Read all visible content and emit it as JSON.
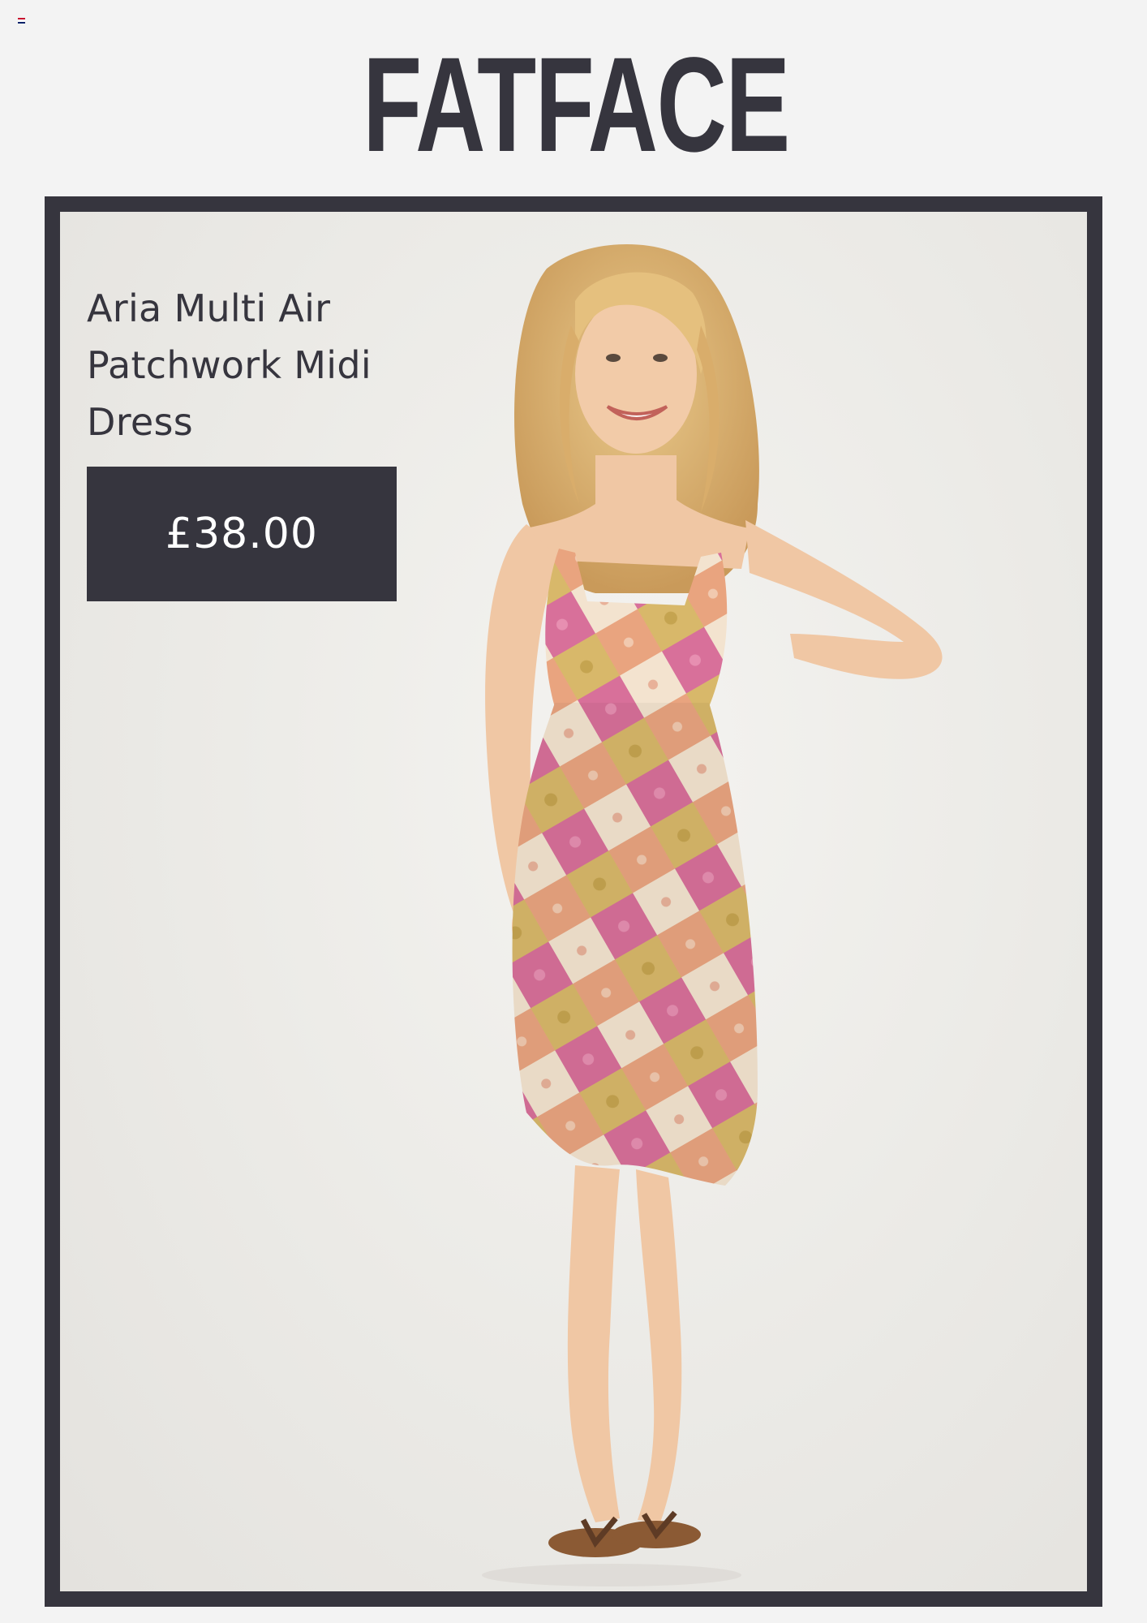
{
  "brand": {
    "logo_text": "FATFACE"
  },
  "product": {
    "title": "Aria Multi Air Patchwork Midi Dress",
    "price": "£38.00"
  },
  "colors": {
    "frame": "#36353e",
    "price_bg": "#36353e",
    "price_text": "#ffffff",
    "page_bg": "#f3f3f3"
  }
}
